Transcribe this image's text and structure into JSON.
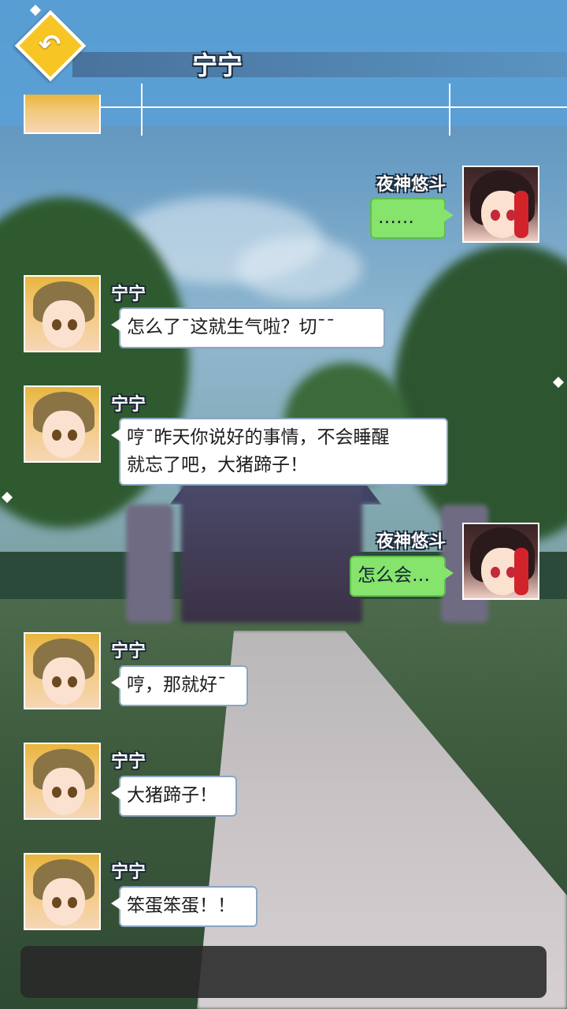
{
  "header": {
    "title": "宁宁",
    "back_icon": "back-arrow-icon"
  },
  "messages": [
    {
      "speaker": "夜神悠斗",
      "text": "……",
      "side": "right"
    },
    {
      "speaker": "宁宁",
      "text": "怎么了¯这就生气啦？切¯¯",
      "side": "left"
    },
    {
      "speaker": "宁宁",
      "text": "哼¯昨天你说好的事情，不会睡醒\n就忘了吧，大猪蹄子！",
      "side": "left"
    },
    {
      "speaker": "夜神悠斗",
      "text": "怎么会…",
      "side": "right"
    },
    {
      "speaker": "宁宁",
      "text": "哼，那就好¯",
      "side": "left"
    },
    {
      "speaker": "宁宁",
      "text": "大猪蹄子！",
      "side": "left"
    },
    {
      "speaker": "宁宁",
      "text": "笨蛋笨蛋！！",
      "side": "left"
    }
  ],
  "colors": {
    "bubble_self": "#86e36b",
    "bubble_other": "#ffffff",
    "header": "#5aa0d7",
    "back_button": "#f7c624"
  }
}
